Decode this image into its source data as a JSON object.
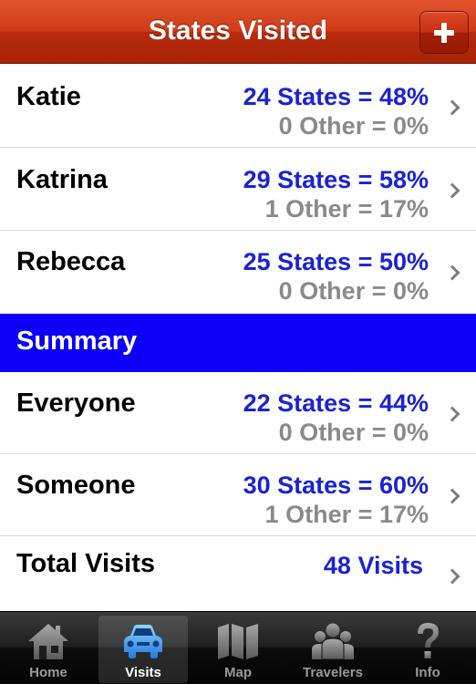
{
  "navbar": {
    "title": "States Visited",
    "add_icon": "plus-icon"
  },
  "travelers": [
    {
      "name": "Katie",
      "states": "24 States = 48%",
      "other": "0 Other = 0%"
    },
    {
      "name": "Katrina",
      "states": "29 States = 58%",
      "other": "1 Other = 17%"
    },
    {
      "name": "Rebecca",
      "states": "25 States = 50%",
      "other": "0 Other = 0%"
    }
  ],
  "summary": {
    "title": "Summary",
    "rows": [
      {
        "name": "Everyone",
        "states": "22 States = 44%",
        "other": "0 Other = 0%"
      },
      {
        "name": "Someone",
        "states": "30 States = 60%",
        "other": "1 Other = 17%"
      }
    ],
    "total": {
      "name": "Total Visits",
      "value": "48 Visits"
    }
  },
  "tabs": [
    {
      "label": "Home",
      "icon": "house-icon",
      "active": false
    },
    {
      "label": "Visits",
      "icon": "car-icon",
      "active": true
    },
    {
      "label": "Map",
      "icon": "map-icon",
      "active": false
    },
    {
      "label": "Travelers",
      "icon": "people-icon",
      "active": false
    },
    {
      "label": "Info",
      "icon": "question-icon",
      "active": false
    }
  ],
  "colors": {
    "navbar": "#c8320f",
    "states_text": "#1a22d6",
    "other_text": "#8a8a8a",
    "section_header": "#0b00f5",
    "tabbar": "#1a1a1a"
  }
}
